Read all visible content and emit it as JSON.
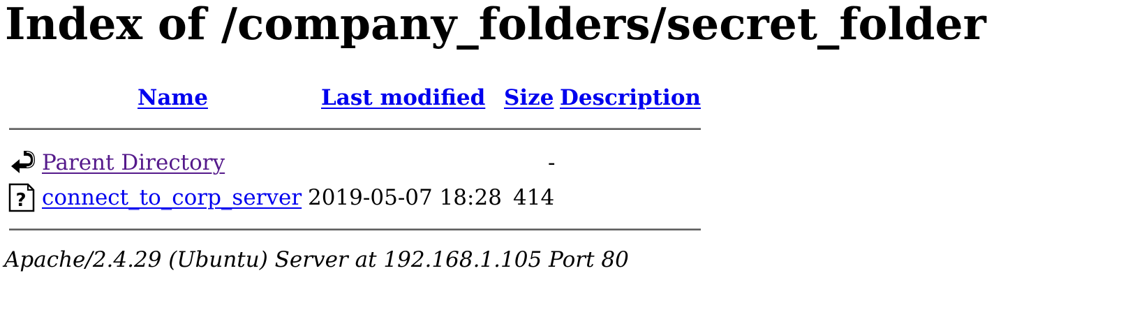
{
  "page": {
    "title": "Index of /company_folders/secret_folder",
    "link_color": "#0000ee",
    "visited_color": "#551a8b"
  },
  "table": {
    "headers": {
      "name": "Name",
      "last_modified": "Last modified",
      "size": "Size",
      "description": "Description"
    },
    "rows": [
      {
        "icon": "back-arrow-icon",
        "name": "Parent Directory",
        "last_modified": "",
        "size": "-",
        "description": "",
        "visited": true
      },
      {
        "icon": "unknown-file-icon",
        "name": "connect_to_corp_server",
        "last_modified": "2019-05-07 18:28",
        "size": "414",
        "description": "",
        "visited": false
      }
    ]
  },
  "footer": {
    "server_signature": "Apache/2.4.29 (Ubuntu) Server at 192.168.1.105 Port 80"
  }
}
